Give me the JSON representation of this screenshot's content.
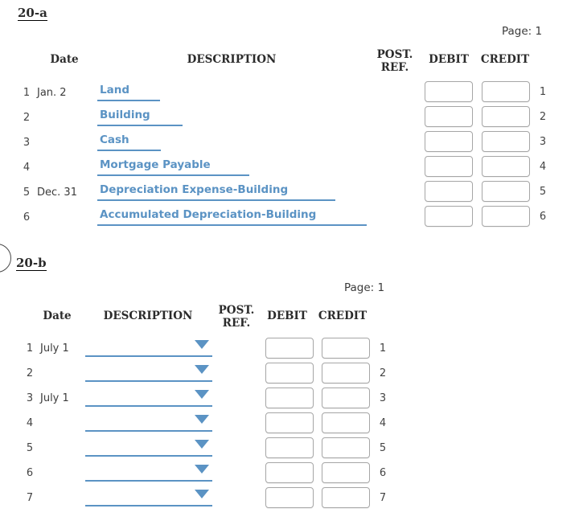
{
  "document": {
    "type": "journal-entry-worksheet",
    "accent_blue": "#5b93c4",
    "box_border": "#a6a6a6"
  },
  "sections": [
    {
      "id": "20-a",
      "label": "20-a",
      "page_label": "Page: 1",
      "headers": {
        "date": "Date",
        "description": "DESCRIPTION",
        "post_ref_line1": "POST.",
        "post_ref_line2": "REF.",
        "debit": "DEBIT",
        "credit": "CREDIT"
      },
      "rows": [
        {
          "num": "1",
          "date": "Jan. 2",
          "description": "Land",
          "debit": "",
          "credit": ""
        },
        {
          "num": "2",
          "date": "",
          "description": "Building",
          "debit": "",
          "credit": ""
        },
        {
          "num": "3",
          "date": "",
          "description": "Cash",
          "debit": "",
          "credit": ""
        },
        {
          "num": "4",
          "date": "",
          "description": "Mortgage Payable",
          "debit": "",
          "credit": ""
        },
        {
          "num": "5",
          "date": "Dec. 31",
          "description": "Depreciation Expense-Building",
          "debit": "",
          "credit": ""
        },
        {
          "num": "6",
          "date": "",
          "description": "Accumulated Depreciation-Building",
          "debit": "",
          "credit": ""
        }
      ]
    },
    {
      "id": "20-b",
      "label": "20-b",
      "page_label": "Page: 1",
      "headers": {
        "date": "Date",
        "description": "DESCRIPTION",
        "post_ref_line1": "POST.",
        "post_ref_line2": "REF.",
        "debit": "DEBIT",
        "credit": "CREDIT"
      },
      "rows": [
        {
          "num": "1",
          "date": "July 1",
          "description": "",
          "debit": "",
          "credit": ""
        },
        {
          "num": "2",
          "date": "",
          "description": "",
          "debit": "",
          "credit": ""
        },
        {
          "num": "3",
          "date": "July 1",
          "description": "",
          "debit": "",
          "credit": ""
        },
        {
          "num": "4",
          "date": "",
          "description": "",
          "debit": "",
          "credit": ""
        },
        {
          "num": "5",
          "date": "",
          "description": "",
          "debit": "",
          "credit": ""
        },
        {
          "num": "6",
          "date": "",
          "description": "",
          "debit": "",
          "credit": ""
        },
        {
          "num": "7",
          "date": "",
          "description": "",
          "debit": "",
          "credit": ""
        }
      ]
    }
  ]
}
